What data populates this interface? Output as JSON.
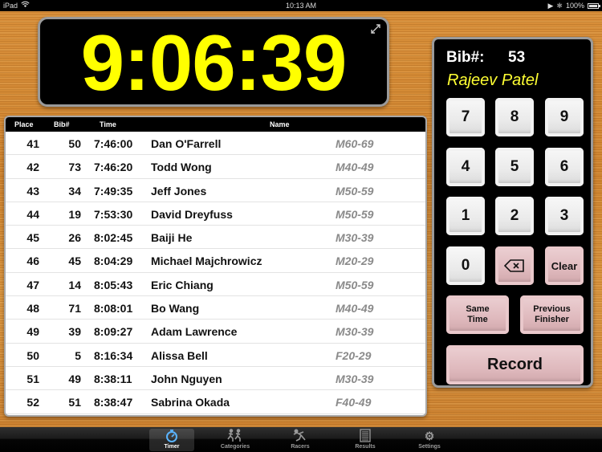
{
  "status_bar": {
    "carrier": "iPad",
    "wifi_icon": "wifi-icon",
    "time": "10:13 AM",
    "play_icon": "▶",
    "bluetooth_icon": "✱",
    "battery": "100%"
  },
  "timer": {
    "elapsed": "9:06:39",
    "expand_icon": "⤢"
  },
  "results_table": {
    "columns": [
      "Place",
      "Bib#",
      "Time",
      "Name"
    ],
    "rows": [
      {
        "place": "41",
        "bib": "50",
        "time": "7:46:00",
        "name": "Dan O'Farrell",
        "category": "M60-69"
      },
      {
        "place": "42",
        "bib": "73",
        "time": "7:46:20",
        "name": "Todd Wong",
        "category": "M40-49"
      },
      {
        "place": "43",
        "bib": "34",
        "time": "7:49:35",
        "name": "Jeff Jones",
        "category": "M50-59"
      },
      {
        "place": "44",
        "bib": "19",
        "time": "7:53:30",
        "name": "David Dreyfuss",
        "category": "M50-59"
      },
      {
        "place": "45",
        "bib": "26",
        "time": "8:02:45",
        "name": "Baiji He",
        "category": "M30-39"
      },
      {
        "place": "46",
        "bib": "45",
        "time": "8:04:29",
        "name": "Michael Majchrowicz",
        "category": "M20-29"
      },
      {
        "place": "47",
        "bib": "14",
        "time": "8:05:43",
        "name": "Eric Chiang",
        "category": "M50-59"
      },
      {
        "place": "48",
        "bib": "71",
        "time": "8:08:01",
        "name": "Bo Wang",
        "category": "M40-49"
      },
      {
        "place": "49",
        "bib": "39",
        "time": "8:09:27",
        "name": "Adam Lawrence",
        "category": "M30-39"
      },
      {
        "place": "50",
        "bib": "5",
        "time": "8:16:34",
        "name": "Alissa Bell",
        "category": "F20-29"
      },
      {
        "place": "51",
        "bib": "49",
        "time": "8:38:11",
        "name": "John Nguyen",
        "category": "M30-39"
      },
      {
        "place": "52",
        "bib": "51",
        "time": "8:38:47",
        "name": "Sabrina Okada",
        "category": "F40-49"
      }
    ]
  },
  "keypad": {
    "bib_label": "Bib#:",
    "bib_value": "53",
    "racer_name": "Rajeev Patel",
    "digits": [
      "7",
      "8",
      "9",
      "4",
      "5",
      "6",
      "1",
      "2",
      "3",
      "0"
    ],
    "backspace_icon": "backspace-icon",
    "clear_label": "Clear",
    "same_time_label_1": "Same",
    "same_time_label_2": "Time",
    "previous_finisher_label_1": "Previous",
    "previous_finisher_label_2": "Finisher",
    "record_label": "Record"
  },
  "tab_bar": {
    "tabs": [
      {
        "label": "Timer",
        "icon": "⏱",
        "active": true
      },
      {
        "label": "Categories",
        "icon": "🏃",
        "active": false
      },
      {
        "label": "Racers",
        "icon": "🏃",
        "active": false
      },
      {
        "label": "Results",
        "icon": "▤",
        "active": false
      },
      {
        "label": "Settings",
        "icon": "⚙",
        "active": false
      }
    ]
  },
  "colors": {
    "timer_digits": "#ffff00",
    "racer_name": "#ffff33",
    "action_key": "#dfb9bd",
    "digit_key": "#eaeaea"
  }
}
